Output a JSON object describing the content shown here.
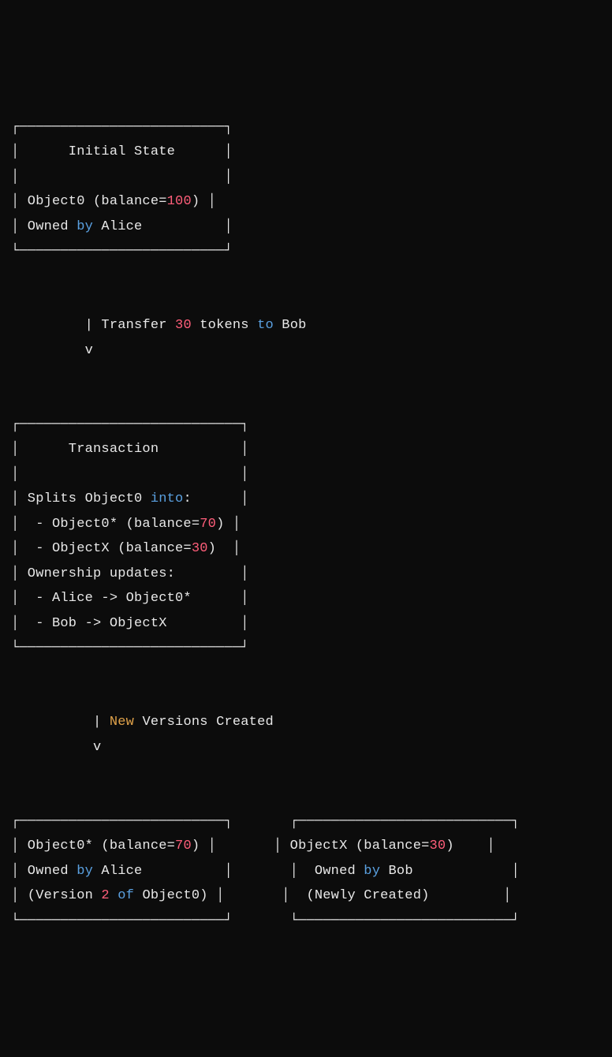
{
  "box1": {
    "top": "┌─────────────────────────┐",
    "title": "│      Initial State      │",
    "blank": "│                         │",
    "l1a": "│ Object0 (balance=",
    "l1n": "100",
    "l1b": ") │",
    "l2a": "│ Owned ",
    "l2k": "by",
    "l2b": " Alice          │",
    "bot": "└─────────────────────────┘"
  },
  "arrow1": {
    "l1a": "         | Transfer ",
    "l1n": "30",
    "l1b": " tokens ",
    "l1k": "to",
    "l1c": " Bob",
    "l2": "         v"
  },
  "box2": {
    "top": "┌───────────────────────────┐",
    "title": "│      Transaction          │",
    "blank": "│                           │",
    "l1a": "│ Splits Object0 ",
    "l1k": "into",
    "l1b": ":      │",
    "l2a": "│  - Object0* (balance=",
    "l2n": "70",
    "l2b": ") │",
    "l3a": "│  - ObjectX (balance=",
    "l3n": "30",
    "l3b": ")  │",
    "l4": "│ Ownership updates:        │",
    "l5": "│  - Alice -> Object0*      │",
    "l6": "│  - Bob -> ObjectX         │",
    "bot": "└───────────────────────────┘"
  },
  "arrow2": {
    "l1a": "          | ",
    "l1k": "New",
    "l1b": " Versions Created",
    "l2": "          v"
  },
  "box3row": {
    "top": "┌─────────────────────────┐       ┌──────────────────────────┐",
    "l1a": "│ Object0* (balance=",
    "l1n": "70",
    "l1b": ") │       │ ObjectX (balance=",
    "l1n2": "30",
    "l1c": ")    │",
    "l2a": "│ Owned ",
    "l2k": "by",
    "l2b": " Alice          │       │  Owned ",
    "l2k2": "by",
    "l2c": " Bob            │",
    "l3a": "│ (Version ",
    "l3n": "2",
    "l3b": " ",
    "l3k": "of",
    "l3c": " Object0) │       │  (Newly Created)         │",
    "bot": "└─────────────────────────┘       └──────────────────────────┘"
  }
}
